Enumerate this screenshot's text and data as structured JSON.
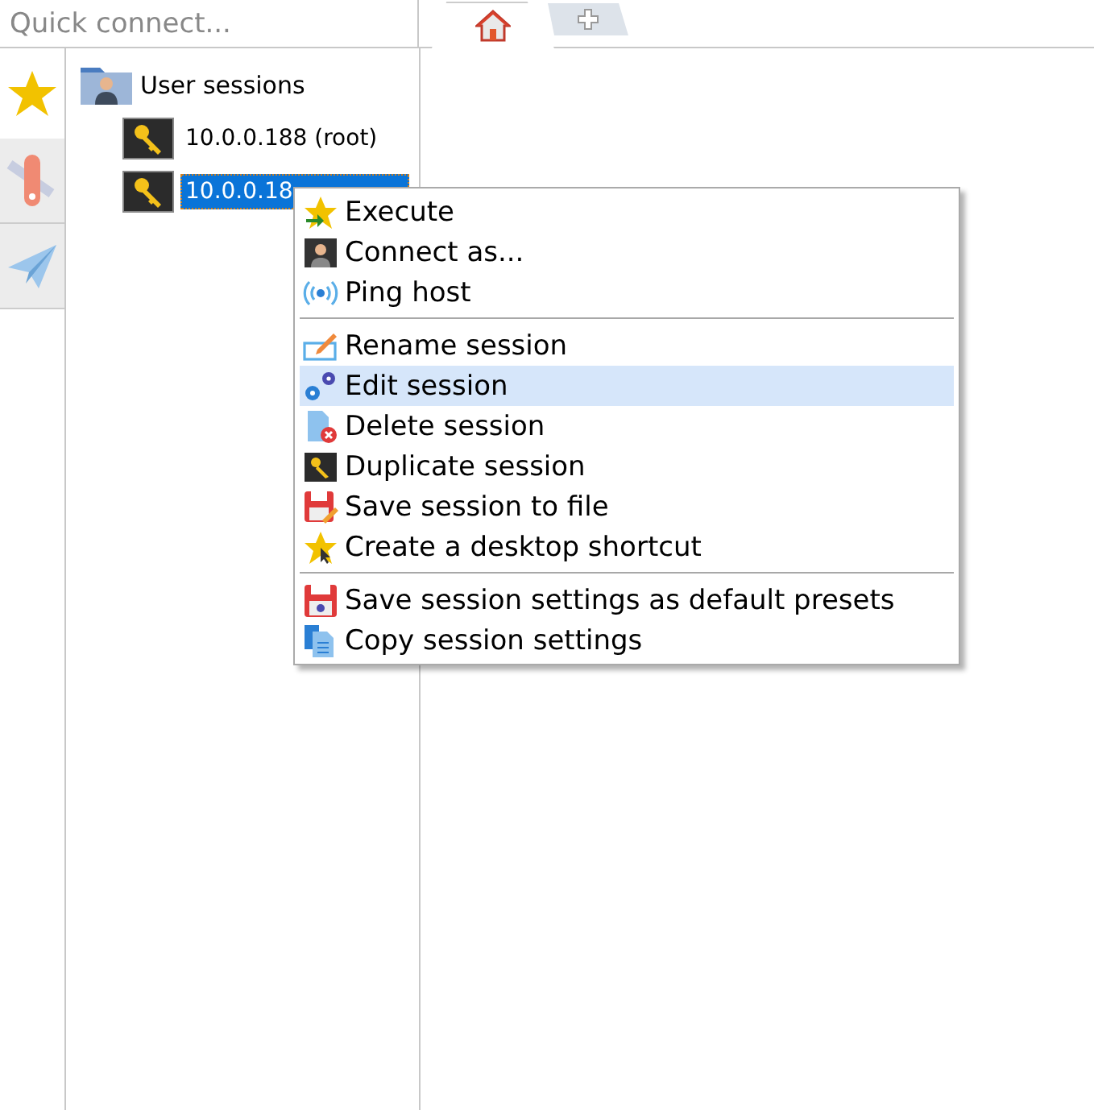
{
  "quick_connect": {
    "placeholder": "Quick connect..."
  },
  "tabs": [
    {
      "kind": "home",
      "selected": true
    },
    {
      "kind": "new",
      "selected": false
    }
  ],
  "side_tools": [
    {
      "kind": "star",
      "selected": true
    },
    {
      "kind": "tools",
      "selected": false
    },
    {
      "kind": "send",
      "selected": false
    }
  ],
  "tree": {
    "label": "User sessions",
    "children": [
      {
        "label": "10.0.0.188 (root)",
        "selected": false
      },
      {
        "label": "10.0.0.18",
        "selected": true
      }
    ]
  },
  "context_menu": {
    "items": [
      {
        "kind": "item",
        "label": "Execute",
        "selected": false
      },
      {
        "kind": "item",
        "label": "Connect as...",
        "selected": false
      },
      {
        "kind": "item",
        "label": "Ping host",
        "selected": false
      },
      {
        "kind": "separator"
      },
      {
        "kind": "item",
        "label": "Rename session",
        "selected": false
      },
      {
        "kind": "item",
        "label": "Edit session",
        "selected": true
      },
      {
        "kind": "item",
        "label": "Delete session",
        "selected": false
      },
      {
        "kind": "item",
        "label": "Duplicate session",
        "selected": false
      },
      {
        "kind": "item",
        "label": "Save session to file",
        "selected": false
      },
      {
        "kind": "item",
        "label": "Create a desktop shortcut",
        "selected": false
      },
      {
        "kind": "separator"
      },
      {
        "kind": "item",
        "label": "Save session settings as default presets",
        "selected": false
      },
      {
        "kind": "item",
        "label": "Copy session settings",
        "selected": false
      }
    ]
  }
}
